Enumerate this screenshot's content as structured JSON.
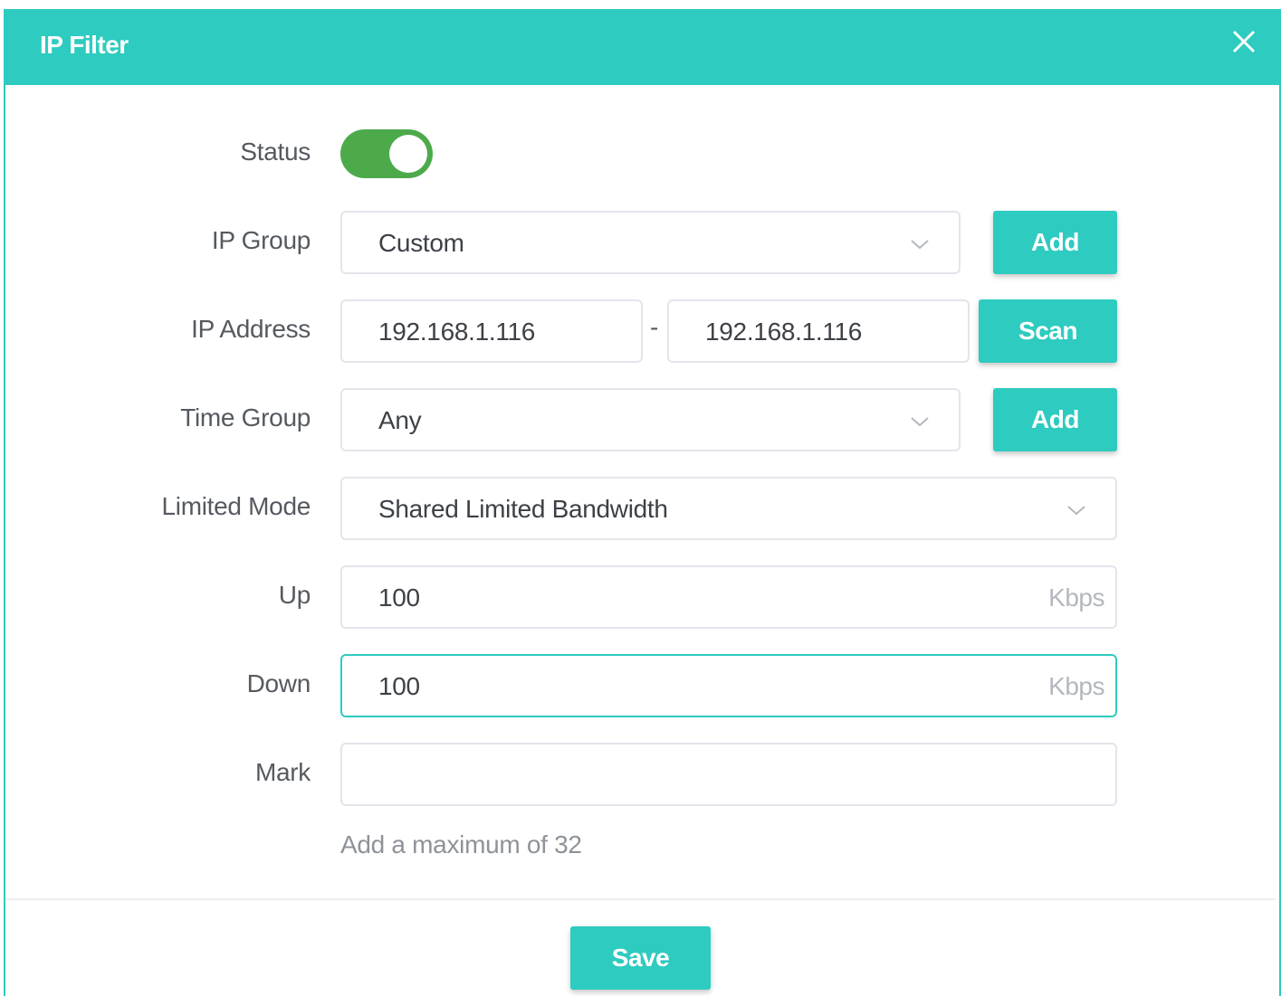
{
  "dialog": {
    "title": "IP Filter",
    "close_icon": "close-icon"
  },
  "form": {
    "status": {
      "label": "Status",
      "enabled": true
    },
    "ip_group": {
      "label": "IP Group",
      "value": "Custom",
      "add_label": "Add"
    },
    "ip_address": {
      "label": "IP Address",
      "start": "192.168.1.116",
      "separator": "-",
      "end": "192.168.1.116",
      "scan_label": "Scan"
    },
    "time_group": {
      "label": "Time Group",
      "value": "Any",
      "add_label": "Add"
    },
    "limited_mode": {
      "label": "Limited Mode",
      "value": "Shared Limited Bandwidth"
    },
    "up": {
      "label": "Up",
      "value": "100",
      "unit": "Kbps"
    },
    "down": {
      "label": "Down",
      "value": "100",
      "unit": "Kbps"
    },
    "mark": {
      "label": "Mark",
      "value": "",
      "hint": "Add a maximum of 32"
    }
  },
  "footer": {
    "save_label": "Save"
  },
  "colors": {
    "accent": "#2ecbc0",
    "toggle_on": "#4caa4b",
    "border": "#e3e5eb"
  }
}
